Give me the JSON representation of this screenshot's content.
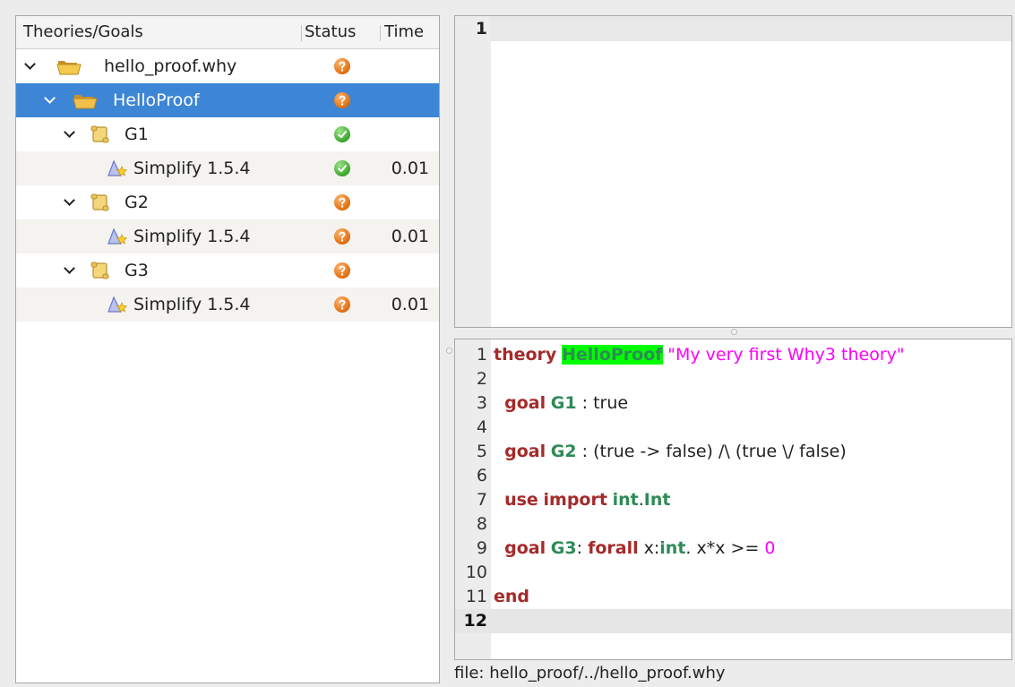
{
  "tree": {
    "headers": {
      "name": "Theories/Goals",
      "status": "Status",
      "time": "Time"
    },
    "rows": [
      {
        "label": "hello_proof.why",
        "kind": "file",
        "status": "unknown",
        "time": ""
      },
      {
        "label": "HelloProof",
        "kind": "theory",
        "status": "unknown",
        "time": "",
        "selected": true
      },
      {
        "label": "G1",
        "kind": "goal",
        "status": "valid",
        "time": ""
      },
      {
        "label": "Simplify 1.5.4",
        "kind": "prover",
        "status": "valid",
        "time": "0.01"
      },
      {
        "label": "G2",
        "kind": "goal",
        "status": "unknown",
        "time": ""
      },
      {
        "label": "Simplify 1.5.4",
        "kind": "prover",
        "status": "unknown",
        "time": "0.01"
      },
      {
        "label": "G3",
        "kind": "goal",
        "status": "unknown",
        "time": ""
      },
      {
        "label": "Simplify 1.5.4",
        "kind": "prover",
        "status": "unknown",
        "time": "0.01"
      }
    ]
  },
  "task_view": {
    "line_number": "1"
  },
  "source": {
    "lines": [
      {
        "n": "1",
        "tokens": [
          [
            "kw",
            "theory"
          ],
          [
            "",
            ""
          ],
          [
            "hl",
            "HelloProof"
          ],
          [
            "",
            ""
          ],
          [
            "str",
            "\"My very first Why3 theory\""
          ]
        ]
      },
      {
        "n": "2",
        "tokens": []
      },
      {
        "n": "3",
        "tokens": [
          [
            "",
            "  "
          ],
          [
            "kw",
            "goal"
          ],
          [
            "",
            ""
          ],
          [
            "id",
            "G1"
          ],
          [
            "",
            " : true"
          ]
        ]
      },
      {
        "n": "4",
        "tokens": []
      },
      {
        "n": "5",
        "tokens": [
          [
            "",
            "  "
          ],
          [
            "kw",
            "goal"
          ],
          [
            "",
            ""
          ],
          [
            "id",
            "G2"
          ],
          [
            "",
            " : (true -> false) /\\ (true \\/ false)"
          ]
        ]
      },
      {
        "n": "6",
        "tokens": []
      },
      {
        "n": "7",
        "tokens": [
          [
            "",
            "  "
          ],
          [
            "kw",
            "use"
          ],
          [
            "",
            ""
          ],
          [
            "kw",
            "import"
          ],
          [
            "",
            ""
          ],
          [
            "id",
            "int"
          ],
          [
            "",
            "."
          ],
          [
            "id",
            "Int"
          ]
        ]
      },
      {
        "n": "8",
        "tokens": []
      },
      {
        "n": "9",
        "tokens": [
          [
            "",
            "  "
          ],
          [
            "kw",
            "goal"
          ],
          [
            "",
            ""
          ],
          [
            "id",
            "G3"
          ],
          [
            "",
            ": "
          ],
          [
            "kw",
            "forall"
          ],
          [
            "",
            " x:"
          ],
          [
            "id",
            "int"
          ],
          [
            "",
            ". x*x >= "
          ],
          [
            "num",
            "0"
          ]
        ]
      },
      {
        "n": "10",
        "tokens": []
      },
      {
        "n": "11",
        "tokens": [
          [
            "kw",
            "end"
          ]
        ]
      },
      {
        "n": "12",
        "tokens": [],
        "current": true
      }
    ]
  },
  "status_bar": {
    "text": "file: hello_proof/../hello_proof.why"
  },
  "colors": {
    "selection": "#3d86d6",
    "keyword": "#a52a2a",
    "identifier": "#2e8b57",
    "string": "#ff00ff",
    "highlight": "#00ff00",
    "status_unknown": "#e06e10",
    "status_valid": "#3aa62a"
  },
  "icons": {
    "file": "folder-open-icon",
    "theory": "folder-open-icon",
    "goal": "scroll-icon",
    "prover": "prover-star-icon",
    "status_unknown": "question-icon",
    "status_valid": "checkmark-icon",
    "expander": "chevron-down-icon"
  }
}
